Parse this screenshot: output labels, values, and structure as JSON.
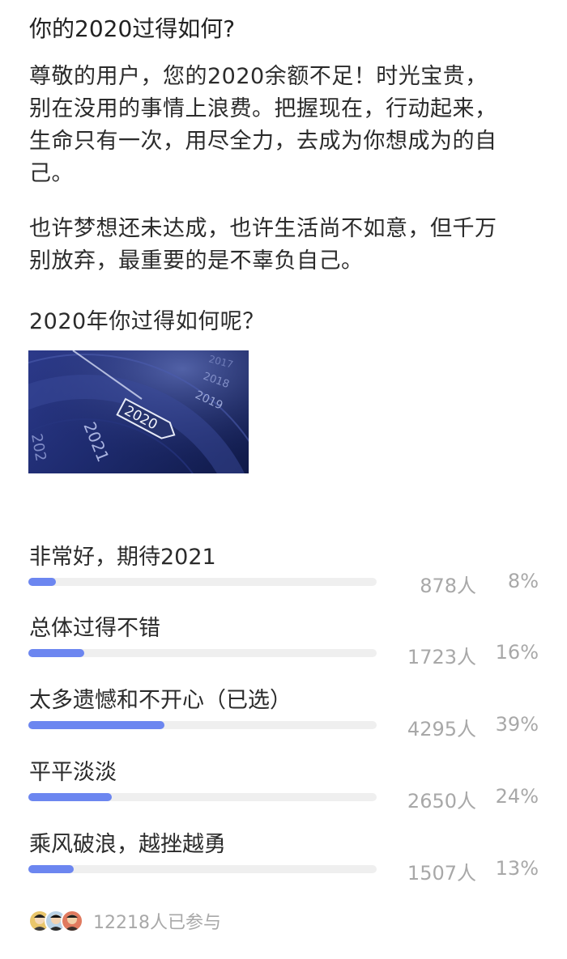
{
  "post": {
    "title": "你的2020过得如何?",
    "paragraph1": [
      "尊敬的用户，您的2020余额不足！时光宝贵，",
      "别在没用的事情上浪费。把握现在，行动起来，",
      "生命只有一次，用尽全力，去成为你想成为的自",
      "己。"
    ],
    "paragraph2": [
      "也许梦想还未达成，也许生活尚不如意，但千万",
      "别放弃，最重要的是不辜负自己。"
    ],
    "question": "2020年你过得如何呢？",
    "banner_numbers": [
      "2021",
      "2020",
      "2019",
      "2018",
      "2017",
      "202"
    ]
  },
  "poll": {
    "options": [
      {
        "label": "非常好，期待2021",
        "count": "878人",
        "percent": "8%",
        "fraction": 0.08
      },
      {
        "label": "总体过得不错",
        "count": "1723人",
        "percent": "16%",
        "fraction": 0.16
      },
      {
        "label": "太多遗憾和不开心（已选）",
        "count": "4295人",
        "percent": "39%",
        "fraction": 0.39
      },
      {
        "label": "平平淡淡",
        "count": "2650人",
        "percent": "24%",
        "fraction": 0.24
      },
      {
        "label": "乘风破浪，越挫越勇",
        "count": "1507人",
        "percent": "13%",
        "fraction": 0.13
      }
    ],
    "participants": "12218人已参与",
    "bar_color": "#6c86f0"
  }
}
